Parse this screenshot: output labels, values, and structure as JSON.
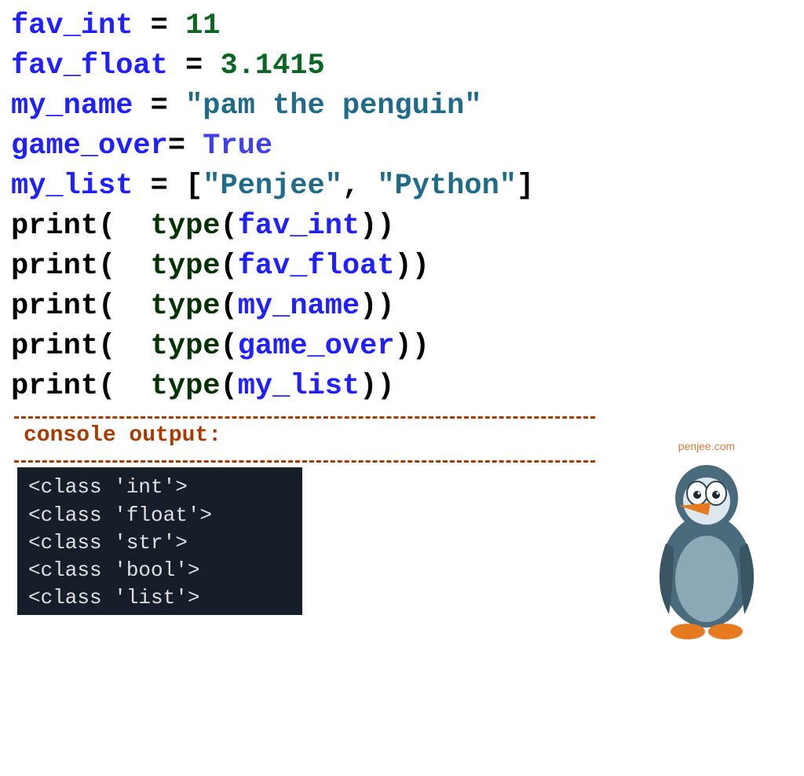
{
  "code_lines": [
    {
      "tokens": [
        {
          "cls": "c-var",
          "t": "fav_int"
        },
        {
          "cls": "c-black",
          "t": " = "
        },
        {
          "cls": "c-num",
          "t": "11"
        }
      ]
    },
    {
      "tokens": [
        {
          "cls": "c-var",
          "t": "fav_float"
        },
        {
          "cls": "c-black",
          "t": " = "
        },
        {
          "cls": "c-num",
          "t": "3.1415"
        }
      ]
    },
    {
      "tokens": [
        {
          "cls": "c-var",
          "t": "my_name"
        },
        {
          "cls": "c-black",
          "t": " = "
        },
        {
          "cls": "c-str",
          "t": "\"pam the penguin\""
        }
      ]
    },
    {
      "tokens": [
        {
          "cls": "c-var",
          "t": "game_over"
        },
        {
          "cls": "c-black",
          "t": "= "
        },
        {
          "cls": "c-bool",
          "t": "True"
        }
      ]
    },
    {
      "tokens": [
        {
          "cls": "c-var",
          "t": "my_list"
        },
        {
          "cls": "c-black",
          "t": " = "
        },
        {
          "cls": "c-black",
          "t": "["
        },
        {
          "cls": "c-str",
          "t": "\"Penjee\""
        },
        {
          "cls": "c-black",
          "t": ", "
        },
        {
          "cls": "c-str",
          "t": "\"Python\""
        },
        {
          "cls": "c-black",
          "t": "]"
        }
      ]
    },
    {
      "tokens": [
        {
          "cls": "c-black",
          "t": "print"
        },
        {
          "cls": "c-black",
          "t": "(  "
        },
        {
          "cls": "c-func",
          "t": "type"
        },
        {
          "cls": "c-black",
          "t": "("
        },
        {
          "cls": "c-var",
          "t": "fav_int"
        },
        {
          "cls": "c-black",
          "t": "))"
        }
      ]
    },
    {
      "tokens": [
        {
          "cls": "c-black",
          "t": "print"
        },
        {
          "cls": "c-black",
          "t": "(  "
        },
        {
          "cls": "c-func",
          "t": "type"
        },
        {
          "cls": "c-black",
          "t": "("
        },
        {
          "cls": "c-var",
          "t": "fav_float"
        },
        {
          "cls": "c-black",
          "t": "))"
        }
      ]
    },
    {
      "tokens": [
        {
          "cls": "c-black",
          "t": "print"
        },
        {
          "cls": "c-black",
          "t": "(  "
        },
        {
          "cls": "c-func",
          "t": "type"
        },
        {
          "cls": "c-black",
          "t": "("
        },
        {
          "cls": "c-var",
          "t": "my_name"
        },
        {
          "cls": "c-black",
          "t": "))"
        }
      ]
    },
    {
      "tokens": [
        {
          "cls": "c-black",
          "t": "print"
        },
        {
          "cls": "c-black",
          "t": "(  "
        },
        {
          "cls": "c-func",
          "t": "type"
        },
        {
          "cls": "c-black",
          "t": "("
        },
        {
          "cls": "c-var",
          "t": "game_over"
        },
        {
          "cls": "c-black",
          "t": "))"
        }
      ]
    },
    {
      "tokens": [
        {
          "cls": "c-black",
          "t": "print"
        },
        {
          "cls": "c-black",
          "t": "(  "
        },
        {
          "cls": "c-func",
          "t": "type"
        },
        {
          "cls": "c-black",
          "t": "("
        },
        {
          "cls": "c-var",
          "t": "my_list"
        },
        {
          "cls": "c-black",
          "t": "))"
        }
      ]
    }
  ],
  "console_label": "console output:",
  "console_output": [
    "<class 'int'>",
    "<class 'float'>",
    "<class 'str'>",
    "<class 'bool'>",
    "<class 'list'>"
  ],
  "attribution": "penjee.com"
}
